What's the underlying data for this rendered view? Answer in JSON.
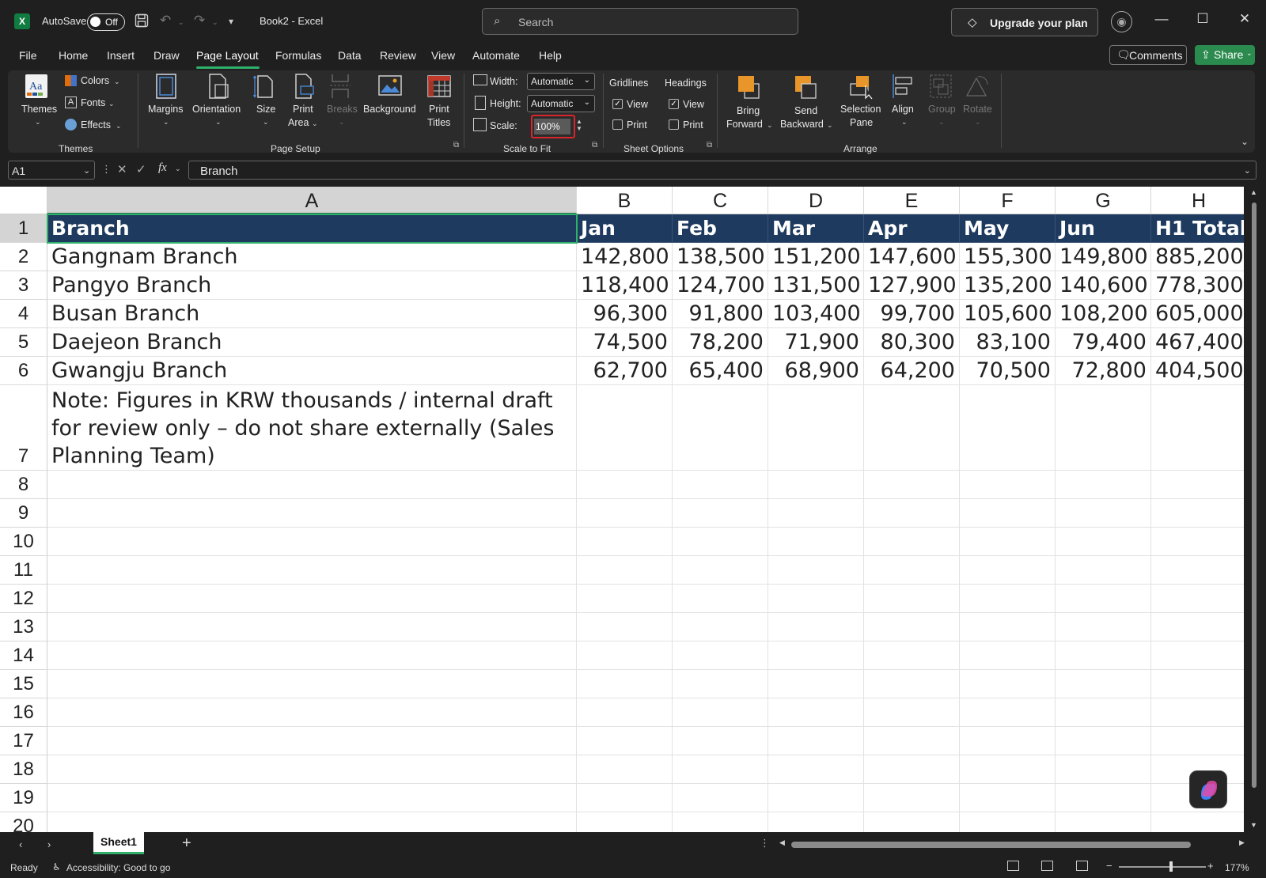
{
  "titlebar": {
    "autosave_label": "AutoSave",
    "autosave_state": "Off",
    "doc_title": "Book2  -  Excel",
    "search_placeholder": "Search",
    "upgrade_label": "Upgrade your plan"
  },
  "menu": {
    "items": [
      "File",
      "Home",
      "Insert",
      "Draw",
      "Page Layout",
      "Formulas",
      "Data",
      "Review",
      "View",
      "Automate",
      "Help"
    ],
    "active": "Page Layout",
    "comments_label": "Comments",
    "share_label": "Share"
  },
  "ribbon": {
    "themes": {
      "themes_label": "Themes",
      "colors_label": "Colors",
      "fonts_label": "Fonts",
      "effects_label": "Effects",
      "group": "Themes"
    },
    "page_setup": {
      "margins": "Margins",
      "orientation": "Orientation",
      "size": "Size",
      "print_area_1": "Print",
      "print_area_2": "Area",
      "breaks": "Breaks",
      "background": "Background",
      "print_titles_1": "Print",
      "print_titles_2": "Titles",
      "group": "Page Setup"
    },
    "scale_to_fit": {
      "width_label": "Width:",
      "width_value": "Automatic",
      "height_label": "Height:",
      "height_value": "Automatic",
      "scale_label": "Scale:",
      "scale_value": "100%",
      "group": "Scale to Fit"
    },
    "sheet_options": {
      "gridlines": "Gridlines",
      "headings": "Headings",
      "view": "View",
      "print": "Print",
      "group": "Sheet Options"
    },
    "arrange": {
      "bring_1": "Bring",
      "bring_2": "Forward",
      "send_1": "Send",
      "send_2": "Backward",
      "selection_1": "Selection",
      "selection_2": "Pane",
      "align": "Align",
      "group_btn": "Group",
      "rotate": "Rotate",
      "group": "Arrange"
    }
  },
  "formula_bar": {
    "name_box": "A1",
    "content": "Branch"
  },
  "sheet": {
    "columns": [
      "A",
      "B",
      "C",
      "D",
      "E",
      "F",
      "G",
      "H"
    ],
    "rows": [
      "1",
      "2",
      "3",
      "4",
      "5",
      "6",
      "7",
      "8",
      "9",
      "10",
      "11",
      "12",
      "13",
      "14",
      "15",
      "16",
      "17",
      "18",
      "19",
      "20"
    ],
    "header": [
      "Branch",
      "Jan",
      "Feb",
      "Mar",
      "Apr",
      "May",
      "Jun",
      "H1 Total"
    ],
    "data": [
      [
        "Gangnam Branch",
        "142,800",
        "138,500",
        "151,200",
        "147,600",
        "155,300",
        "149,800",
        "885,200"
      ],
      [
        "Pangyo Branch",
        "118,400",
        "124,700",
        "131,500",
        "127,900",
        "135,200",
        "140,600",
        "778,300"
      ],
      [
        "Busan Branch",
        "96,300",
        "91,800",
        "103,400",
        "99,700",
        "105,600",
        "108,200",
        "605,000"
      ],
      [
        "Daejeon Branch",
        "74,500",
        "78,200",
        "71,900",
        "80,300",
        "83,100",
        "79,400",
        "467,400"
      ],
      [
        "Gwangju Branch",
        "62,700",
        "65,400",
        "68,900",
        "64,200",
        "70,500",
        "72,800",
        "404,500"
      ]
    ],
    "note": "Note: Figures in KRW thousands / internal draft for review only – do not share externally (Sales Planning Team)"
  },
  "tabs": {
    "sheet1": "Sheet1",
    "add": "+"
  },
  "status": {
    "ready": "Ready",
    "accessibility": "Accessibility: Good to go",
    "zoom": "177%"
  },
  "colors": {
    "header_fill": "#1e3a5f",
    "accent": "#2fb06b",
    "excel_green": "#107c41"
  }
}
